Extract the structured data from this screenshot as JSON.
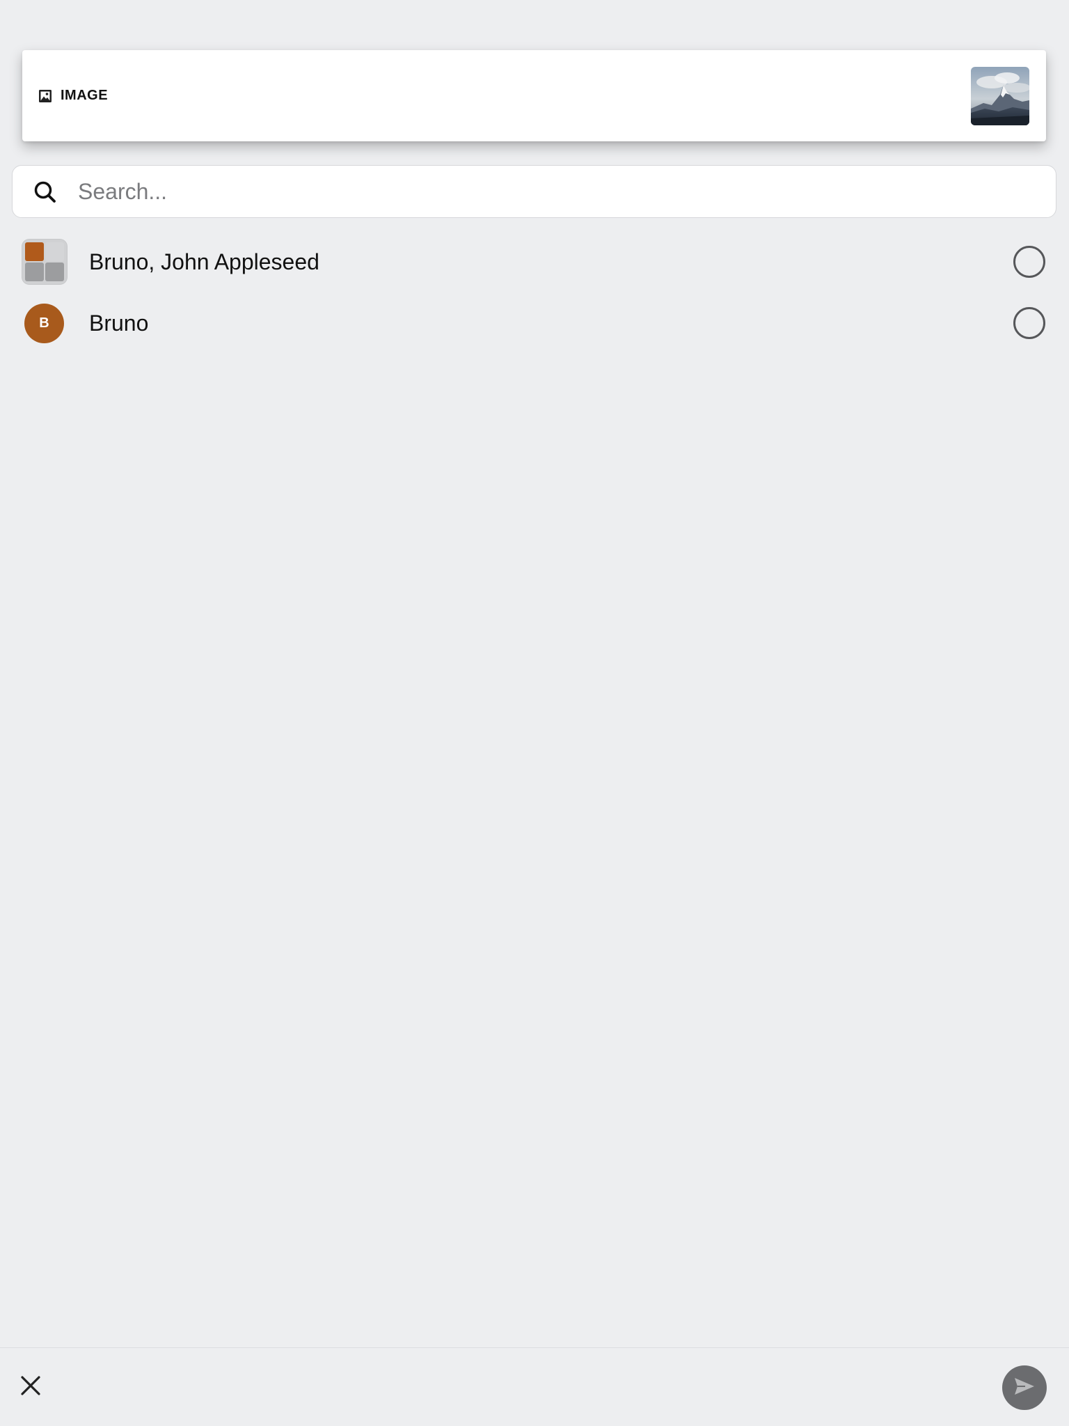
{
  "preview": {
    "type_label": "IMAGE",
    "type_icon": "image-icon",
    "thumbnail_icon": "mountain-photo-thumbnail"
  },
  "search": {
    "placeholder": "Search...",
    "value": "",
    "icon": "search-icon"
  },
  "contacts": [
    {
      "name": "Bruno, John Appleseed",
      "avatar_type": "group",
      "selected": false
    },
    {
      "name": "Bruno",
      "avatar_type": "initial",
      "initial": "B",
      "avatar_color": "#a85a1c",
      "selected": false
    }
  ],
  "bottom_bar": {
    "close_icon": "close-icon",
    "send_icon": "send-icon"
  },
  "colors": {
    "background": "#edeef0",
    "accent_avatar": "#a85a1c",
    "send_button": "#6b6c6f"
  }
}
